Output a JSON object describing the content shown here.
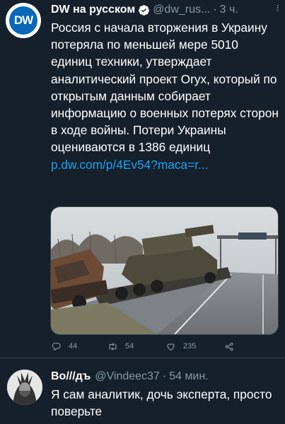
{
  "tweet": {
    "avatar_label": "DW",
    "author_name": "DW на русском",
    "handle": "@dw_rus...",
    "separator": "·",
    "time": "3 ч.",
    "more": "⁝",
    "text": "Россия с начала вторжения в Украину потеряла по меньшей мере 5010 единиц техники, утверждает аналитический проект Oryx, который по открытым данным собирает информацию о военных потерях сторон в ходе войны. Потери Украины оцениваются в 1386 единиц",
    "link": "p.dw.com/p/4Ev54?maca=r...",
    "actions": {
      "replies": "44",
      "retweets": "54",
      "likes": "235"
    }
  },
  "reply": {
    "author_name": "Во///дъ",
    "handle": "@Vindeec37",
    "separator": "·",
    "time": "54 мин.",
    "text": "Я сам аналитик, дочь эксперта, просто поверьте"
  },
  "colors": {
    "background": "#15202b",
    "secondary_text": "#8899a6",
    "link": "#1da1f2",
    "divider": "#38444d"
  }
}
